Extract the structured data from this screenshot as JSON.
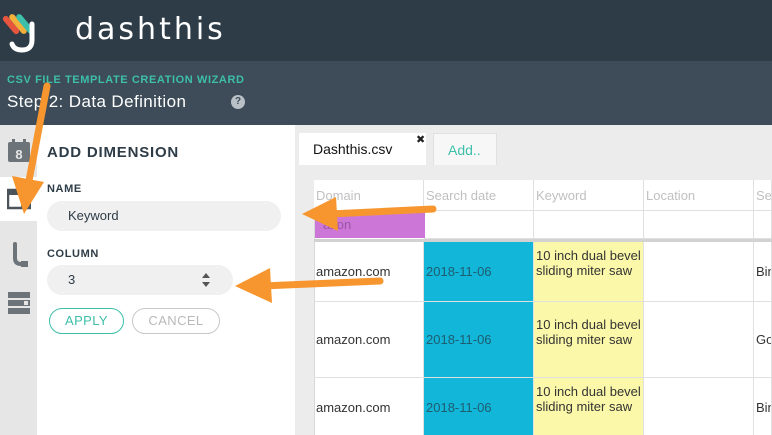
{
  "app": {
    "brand": "dashthis"
  },
  "wizard": {
    "kicker": "CSV FILE TEMPLATE CREATION WIZARD",
    "step": "Step 2: Data Definition",
    "help_glyph": "?"
  },
  "rail": {
    "items": [
      {
        "icon": "calendar-icon",
        "text": "8"
      },
      {
        "icon": "dimension-icon"
      },
      {
        "icon": "pointer-icon"
      },
      {
        "icon": "rows-icon"
      }
    ]
  },
  "panel": {
    "title": "ADD DIMENSION",
    "name_label": "NAME",
    "name_value": "Keyword",
    "column_label": "COLUMN",
    "column_value": "3",
    "apply_label": "APPLY",
    "cancel_label": "CANCEL"
  },
  "tabs": {
    "file": "Dashthis.csv",
    "close": "✖",
    "add": "Add.."
  },
  "table": {
    "headers": [
      "Domain",
      "Search date",
      "Keyword",
      "Location",
      "Se"
    ],
    "purple_tag": "azon",
    "rows": [
      {
        "domain": "amazon.com",
        "date": "2018-11-06",
        "keyword": "10 inch dual bevel sliding miter saw",
        "location": "",
        "se": "Bin"
      },
      {
        "domain": "amazon.com",
        "date": "2018-11-06",
        "keyword": "10 inch dual bevel sliding miter saw",
        "location": "",
        "se": "Go"
      },
      {
        "domain": "amazon.com",
        "date": "2018-11-06",
        "keyword": "10 inch dual bevel sliding miter saw",
        "location": "",
        "se": "Bin"
      }
    ]
  },
  "colors": {
    "header_bg": "#2e3c47",
    "wizard_bg": "#3d4c58",
    "accent_teal": "#3dbfa9",
    "date_cyan": "#12b6d9",
    "keyword_yellow": "#fbf8a9",
    "tag_purple": "#cc77d8",
    "arrow_orange": "#f7962f"
  }
}
